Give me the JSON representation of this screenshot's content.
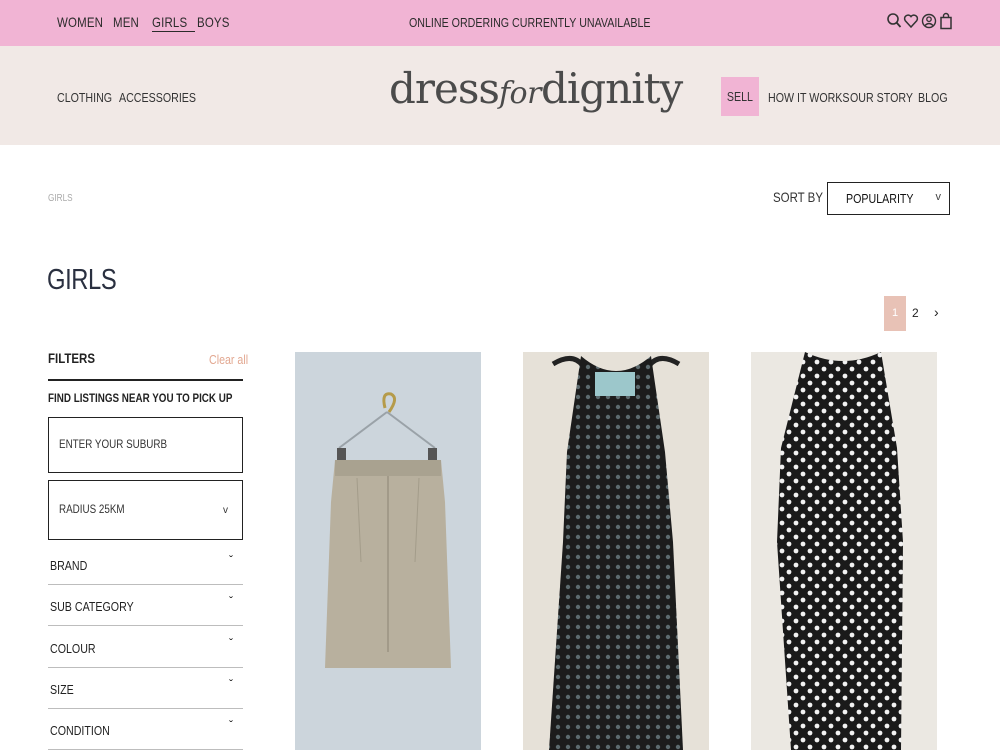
{
  "topbar": {
    "genders": [
      {
        "label": "WOMEN",
        "active": false
      },
      {
        "label": "MEN",
        "active": false
      },
      {
        "label": "GIRLS",
        "active": true
      },
      {
        "label": "BOYS",
        "active": false
      }
    ],
    "notice": "ONLINE ORDERING CURRENTLY UNAVAILABLE",
    "icons": [
      "search-icon",
      "heart-icon",
      "user-icon",
      "bag-icon"
    ]
  },
  "header": {
    "nav_left": [
      "CLOTHING",
      "ACCESSORIES"
    ],
    "logo": {
      "part1": "dress",
      "part2": "for",
      "part3": "dignity"
    },
    "nav_right": {
      "sell": "SELL",
      "how": "HOW IT WORKS",
      "story": "OUR STORY",
      "blog": "BLOG"
    }
  },
  "breadcrumb": "GIRLS",
  "sort": {
    "label": "SORT BY",
    "value": "POPULARITY"
  },
  "page_title": "GIRLS",
  "pagination": {
    "current": "1",
    "next_page": "2"
  },
  "filters": {
    "title": "FILTERS",
    "clear": "Clear all",
    "near_label": "FIND LISTINGS NEAR YOU TO PICK UP",
    "suburb_placeholder": "ENTER YOUR SUBURB",
    "radius": "RADIUS  25KM",
    "facets": [
      "BRAND",
      "SUB CATEGORY",
      "COLOUR",
      "SIZE",
      "CONDITION"
    ]
  },
  "colors": {
    "topbar": "#f1b4d4",
    "header": "#f1e9e6",
    "accent_peach": "#e8c2b6",
    "clear_link": "#e2a790"
  },
  "products": [
    "beige-pencil-skirt-image",
    "black-lace-halter-dress-image",
    "black-polka-dot-dress-image"
  ]
}
